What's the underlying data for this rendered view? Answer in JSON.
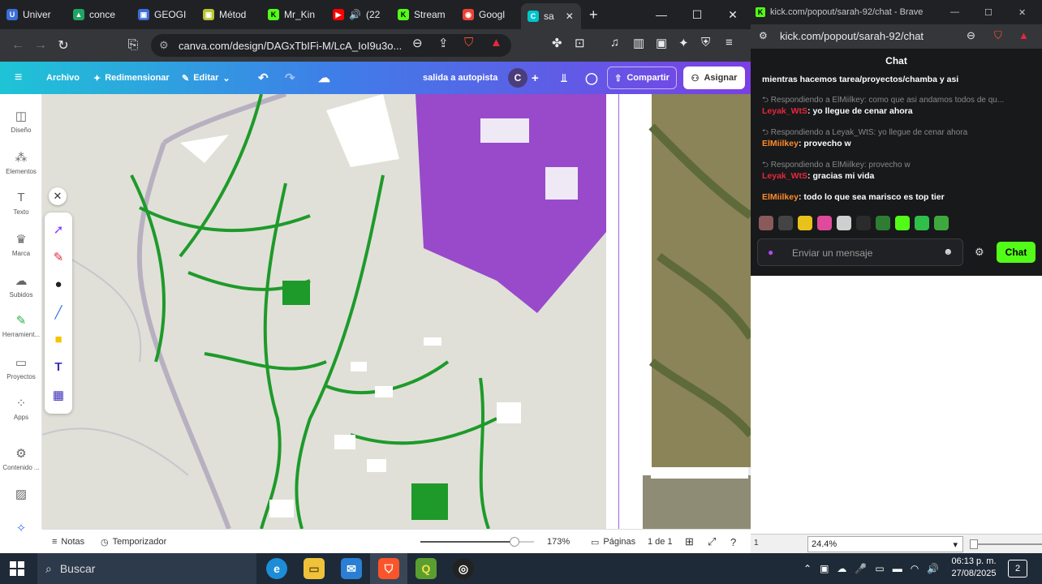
{
  "tabs": [
    {
      "label": "Univer",
      "color": "#3b6ed8",
      "glyph": "U"
    },
    {
      "label": "conce",
      "color": "#1fa463",
      "glyph": "▲"
    },
    {
      "label": "GEOGI",
      "color": "#3b6ed8",
      "glyph": "▣"
    },
    {
      "label": "Métod",
      "color": "#b6c532",
      "glyph": "▣"
    },
    {
      "label": "Mr_Kin",
      "color": "#53fc18",
      "glyph": "K"
    },
    {
      "label": "(22",
      "color": "#ff0000",
      "glyph": "▶"
    },
    {
      "label": "Stream",
      "color": "#53fc18",
      "glyph": "K"
    },
    {
      "label": "Googl",
      "color": "#ea4335",
      "glyph": "◉"
    },
    {
      "label": "sa",
      "color": "#00c4cc",
      "glyph": "C"
    }
  ],
  "url": "canva.com/design/DAGxTbIFi-M/LcA_IoI9u3o...",
  "canva": {
    "archivo": "Archivo",
    "redimensionar": "Redimensionar",
    "editar": "Editar",
    "title": "salida a autopista",
    "avatar": "C",
    "compartir": "Compartir",
    "asignar": "Asignar"
  },
  "rail": [
    {
      "label": "Diseño",
      "icon": "layout-icon",
      "glyph": "◫"
    },
    {
      "label": "Elementos",
      "icon": "elements-icon",
      "glyph": "⁂"
    },
    {
      "label": "Texto",
      "icon": "text-icon",
      "glyph": "T"
    },
    {
      "label": "Marca",
      "icon": "brand-icon",
      "glyph": "♛"
    },
    {
      "label": "Subidos",
      "icon": "upload-icon",
      "glyph": "☁"
    },
    {
      "label": "Herramient...",
      "icon": "tools-icon",
      "glyph": "✎"
    },
    {
      "label": "Proyectos",
      "icon": "folder-icon",
      "glyph": "▭"
    },
    {
      "label": "Apps",
      "icon": "apps-icon",
      "glyph": "⁘"
    },
    {
      "label": "Contenido ...",
      "icon": "content-icon",
      "glyph": "⚙"
    }
  ],
  "bottom": {
    "notas": "Notas",
    "temporizador": "Temporizador",
    "zoom": "173%",
    "zoom_fraction": 0.83,
    "paginas": "Páginas",
    "page_count": "1 de 1"
  },
  "kick": {
    "window_title": "kick.com/popout/sarah-92/chat - Brave",
    "address": "kick.com/popout/sarah-92/chat",
    "chat_title": "Chat",
    "messages": [
      {
        "type": "text",
        "text": "mientras hacemos tarea/proyectos/chamba y asi"
      },
      {
        "type": "reply",
        "text": "Respondiendo a ElMiilkey: como que asi andamos todos de qu..."
      },
      {
        "type": "msg",
        "user": "Leyak_WtS",
        "user_color": "#e5283b",
        "text": "yo llegue de cenar ahora"
      },
      {
        "type": "reply",
        "text": "Respondiendo a Leyak_WtS: yo llegue de cenar ahora"
      },
      {
        "type": "msg",
        "user": "ElMiilkey",
        "user_color": "#ff8c2a",
        "text": "provecho w"
      },
      {
        "type": "reply",
        "text": "Respondiendo a ElMiilkey: provecho w"
      },
      {
        "type": "msg",
        "user": "Leyak_WtS",
        "user_color": "#e5283b",
        "text": "gracias mi vida"
      },
      {
        "type": "msg",
        "user": "ElMiilkey",
        "user_color": "#ff8c2a",
        "text": "todo lo que sea marisco es top tier"
      }
    ],
    "input_placeholder": "Enviar un mensaje",
    "send_label": "Chat",
    "zoom_value": "24.4%",
    "page_indicator": "1"
  },
  "taskbar": {
    "search": "Buscar",
    "time": "06:13 p. m.",
    "date": "27/08/2025",
    "notifications": "2"
  }
}
